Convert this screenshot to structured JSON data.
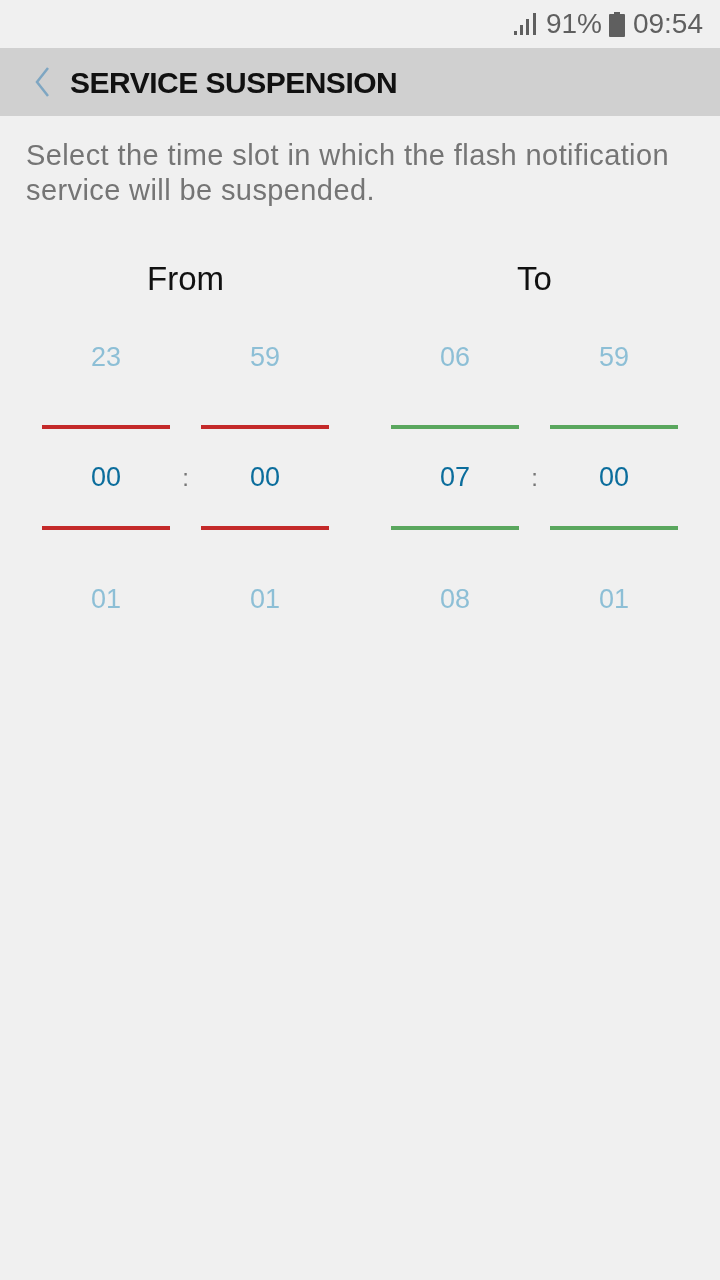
{
  "status_bar": {
    "battery": "91%",
    "time": "09:54"
  },
  "header": {
    "title": "SERVICE SUSPENSION"
  },
  "description": "Select the time slot in which the flash notification service will be suspended.",
  "pickers": [
    {
      "label": "From",
      "color": "#c42a2a",
      "separator": ":",
      "wheels": [
        {
          "previous": "23",
          "current": "00",
          "next": "01"
        },
        {
          "previous": "59",
          "current": "00",
          "next": "01"
        }
      ]
    },
    {
      "label": "To",
      "color": "#5aa75e",
      "separator": ":",
      "wheels": [
        {
          "previous": "06",
          "current": "07",
          "next": "08"
        },
        {
          "previous": "59",
          "current": "00",
          "next": "01"
        }
      ]
    }
  ]
}
